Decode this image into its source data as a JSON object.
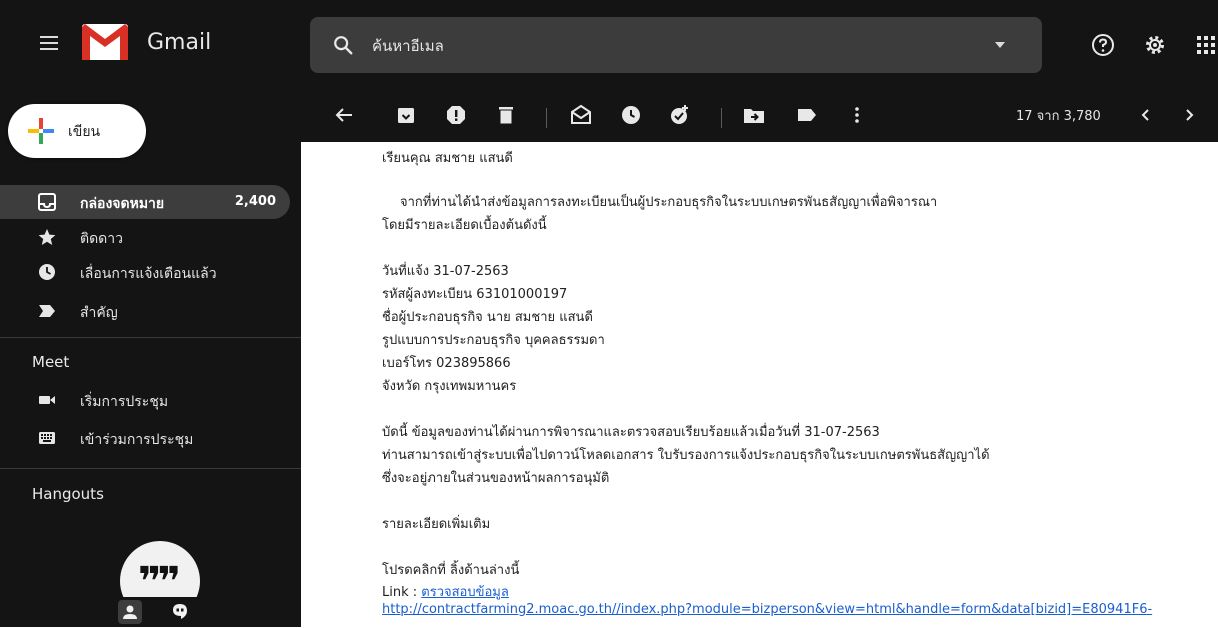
{
  "app": {
    "brand": "Gmail"
  },
  "search": {
    "placeholder": "ค้นหาอีเมล"
  },
  "compose": {
    "label": "เขียน"
  },
  "sidebar": {
    "items": [
      {
        "label": "กล่องจดหมาย",
        "count": "2,400",
        "icon": "inbox-icon"
      },
      {
        "label": "ติดดาว",
        "icon": "star-icon"
      },
      {
        "label": "เลื่อนการแจ้งเตือนแล้ว",
        "icon": "clock-icon"
      },
      {
        "label": "สำคัญ",
        "icon": "important-icon"
      }
    ],
    "meet_title": "Meet",
    "meet_items": [
      {
        "label": "เริ่มการประชุม",
        "icon": "video-icon"
      },
      {
        "label": "เข้าร่วมการประชุม",
        "icon": "keyboard-icon"
      }
    ],
    "hangouts_title": "Hangouts"
  },
  "toolbar": {
    "pager": "17 จาก 3,780"
  },
  "email": {
    "greeting": "เรียนคุณ สมชาย แสนดี",
    "intro1": "จากที่ท่านได้นำส่งข้อมูลการลงทะเบียนเป็นผู้ประกอบธุรกิจในระบบเกษตรพันธสัญญาเพื่อพิจารณา",
    "intro2": "โดยมีรายละเอียดเบื้องต้นดังนี้",
    "date_line": "วันที่แจ้ง 31-07-2563",
    "reg_line": "รหัสผู้ลงทะเบียน 63101000197",
    "name_line": "ชื่อผู้ประกอบธุรกิจ นาย สมชาย แสนดี",
    "type_line": "รูปแบบการประกอบธุรกิจ บุคคลธรรมดา",
    "phone_line": "เบอร์โทร 023895866",
    "province_line": "จังหวัด กรุงเทพมหานคร",
    "body1": "บัดนี้ ข้อมูลของท่านได้ผ่านการพิจารณาและตรวจสอบเรียบร้อยแล้วเมื่อวันที่ 31-07-2563",
    "body2": "ท่านสามารถเข้าสู่ระบบเพื่อไปดาวน์โหลดเอกสาร ใบรับรองการแจ้งประกอบธุรกิจในระบบเกษตรพันธสัญญาได้",
    "body3": "ซึ่งจะอยู่ภายในส่วนของหน้าผลการอนุมัติ",
    "more": "รายละเอียดเพิ่มเติม",
    "click_line": "โปรดคลิกที่ ลิ้งด้านล่างนี้",
    "link_prefix": "Link : ",
    "link_text": "ตรวจสอบข้อมูล",
    "url": "http://contractfarming2.moac.go.th//index.php?module=bizperson&view=html&handle=form&data[bizid]=E80941F6-"
  },
  "colors": {
    "background_dark": "#141414",
    "link": "#1a5fd0",
    "gmail_red": "#d93025"
  }
}
